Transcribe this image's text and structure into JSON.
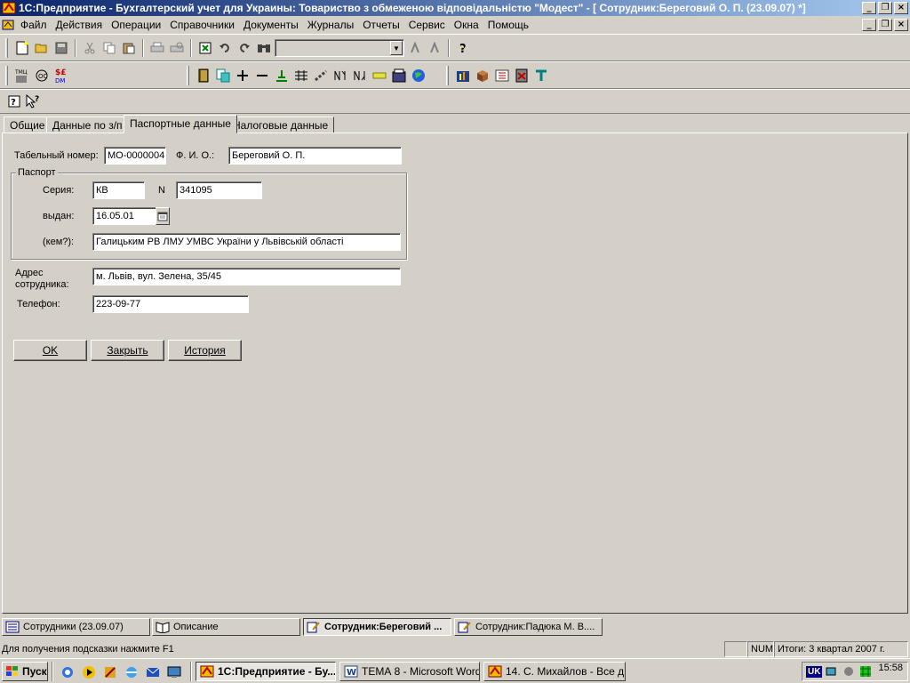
{
  "window": {
    "title": "1С:Предприятие - Бухгалтерский учет для Украины: Товариство  з  обмеженою  відповідальністю  \"Модест\" - [ Сотрудник:Береговий О. П. (23.09.07) *]"
  },
  "menu": {
    "items": [
      "Файл",
      "Действия",
      "Операции",
      "Справочники",
      "Документы",
      "Журналы",
      "Отчеты",
      "Сервис",
      "Окна",
      "Помощь"
    ]
  },
  "tabs": [
    "Общие",
    "Данные по з/п",
    "Паспортные данные",
    "Налоговые данные"
  ],
  "active_tab": "Паспортные данные",
  "form": {
    "tab_number_label": "Табельный номер:",
    "tab_number_value": "МО-0000004",
    "fio_label": "Ф. И. О.:",
    "fio_value": "Береговий О. П.",
    "passport_group": "Паспорт",
    "series_label": "Серия:",
    "series_value": "КВ",
    "number_label": "N",
    "number_value": "341095",
    "issued_label": "выдан:",
    "issued_value": "16.05.01",
    "issued_by_label": "(кем?):",
    "issued_by_value": "Галицьким РВ ЛМУ УМВС України  у  Львівській  області",
    "address_label_1": "Адрес",
    "address_label_2": "сотрудника:",
    "address_value": "м. Львів, вул. Зелена, 35/45",
    "phone_label": "Телефон:",
    "phone_value": "223-09-77"
  },
  "buttons": {
    "ok": "OK",
    "close": "Закрыть",
    "history": "История"
  },
  "window_tabs": [
    {
      "label": "Сотрудники (23.09.07)",
      "active": false
    },
    {
      "label": "Описание",
      "active": false
    },
    {
      "label": "Сотрудник:Береговий ...",
      "active": true
    },
    {
      "label": "Сотрудник:Падюка М. В....",
      "active": false
    }
  ],
  "status": {
    "hint": "Для получения подсказки нажмите F1",
    "num": "NUM",
    "totals": "Итоги: 3 квартал 2007 г."
  },
  "taskbar": {
    "start": "Пуск",
    "tasks": [
      {
        "label": "1С:Предприятие - Бу...",
        "active": true
      },
      {
        "label": "ТЕМА 8 - Microsoft Word",
        "active": false
      },
      {
        "label": "14. С. Михайлов - Все д...",
        "active": false
      }
    ],
    "lang": "UK",
    "clock": "15:58"
  },
  "colors": {
    "title_start": "#0a246a",
    "title_end": "#a6caf0",
    "face": "#d4d0c8"
  }
}
